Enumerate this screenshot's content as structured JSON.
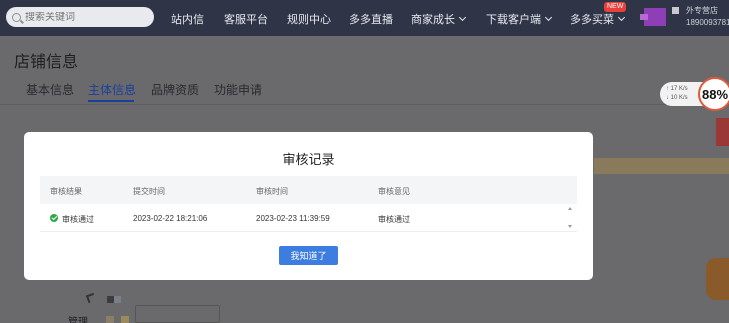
{
  "topbar": {
    "search": {
      "placeholder": "搜索关键词"
    },
    "nav": [
      {
        "label": "站内信"
      },
      {
        "label": "客服平台"
      },
      {
        "label": "规则中心"
      },
      {
        "label": "多多直播"
      },
      {
        "label": "商家成长"
      },
      {
        "label": "下载客户端"
      },
      {
        "label": "多多买菜"
      }
    ],
    "new_badge": "NEW",
    "store": {
      "name": "外专营店",
      "id": "1890093781"
    }
  },
  "page": {
    "title": "店铺信息",
    "tabs": [
      {
        "label": "基本信息",
        "active": false
      },
      {
        "label": "主体信息",
        "active": true
      },
      {
        "label": "品牌资质",
        "active": false
      },
      {
        "label": "功能申请",
        "active": false
      }
    ],
    "speed": {
      "up": "17 K/s",
      "down": "10 K/s"
    },
    "cpu_percent": "88%",
    "bottom_label": "管理"
  },
  "modal": {
    "title": "审核记录",
    "columns": [
      "审核结果",
      "提交时间",
      "审核时间",
      "审核意见"
    ],
    "rows": [
      {
        "result": "审核通过",
        "submit_time": "2023-02-22 18:21:06",
        "review_time": "2023-02-23 11:39:59",
        "opinion": "审核通过"
      }
    ],
    "confirm_button": "我知道了"
  },
  "colors": {
    "topbar_bg": "#2f3546",
    "accent": "#3e7de0",
    "active_tab": "#1c3f9a",
    "success": "#2aa84a"
  }
}
